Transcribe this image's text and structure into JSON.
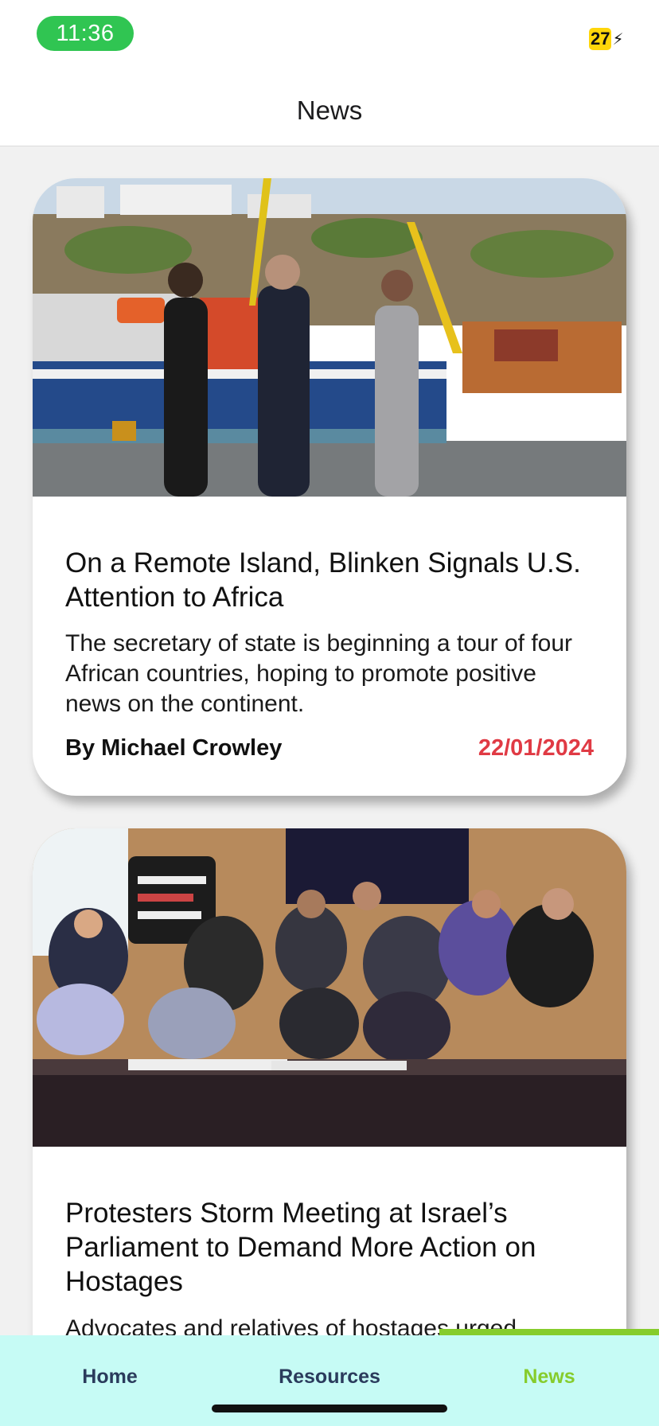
{
  "status_bar": {
    "time": "11:36",
    "battery_level": "27",
    "battery_color": "#ffd60a",
    "charging_icon": "bolt-icon"
  },
  "header": {
    "title": "News"
  },
  "articles": [
    {
      "title": "On a Remote Island, Blinken Signals U.S. Attention to Africa",
      "description": "The secretary of state is beginning a tour of four African countries, hoping to promote positive news on the continent.",
      "author": "By Michael Crowley",
      "date": "22/01/2024"
    },
    {
      "title": "Protesters Storm Meeting at Israel’s Parliament to Demand More Action on Hostages",
      "description": "Advocates and relatives of hostages urged lawmakers to act.",
      "author": "",
      "date": ""
    }
  ],
  "tab_bar": {
    "tabs": [
      {
        "label": "Home",
        "active": false
      },
      {
        "label": "Resources",
        "active": false
      },
      {
        "label": "News",
        "active": true
      }
    ],
    "active_color": "#86cc2c",
    "inactive_color": "#2a3b5c",
    "background": "#c6fbf5"
  },
  "colors": {
    "time_pill": "#30c552",
    "date_accent": "#e03a44"
  }
}
